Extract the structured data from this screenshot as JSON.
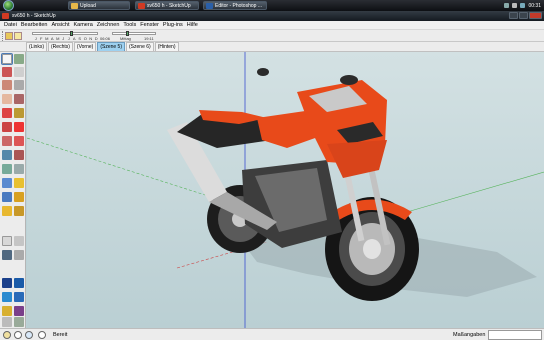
{
  "taskbar": {
    "buttons": [
      {
        "label": "Upload"
      },
      {
        "label": "sv650 h - SketchUp"
      },
      {
        "label": "Editor - Photoshop ..."
      }
    ],
    "clock": "00:31"
  },
  "window": {
    "title": "sv650 h - SketchUp"
  },
  "menu": {
    "items": [
      "Datei",
      "Bearbeiten",
      "Ansicht",
      "Kamera",
      "Zeichnen",
      "Tools",
      "Fenster",
      "Plug-ins",
      "Hilfe"
    ]
  },
  "shadow": {
    "months": [
      "J",
      "F",
      "M",
      "A",
      "M",
      "J",
      "J",
      "A",
      "S",
      "O",
      "N",
      "D"
    ],
    "time_start": "06:06",
    "noon_label": "Mittag",
    "time_end": "19:11"
  },
  "scenes": {
    "tabs": [
      "(Links)",
      "(Rechts)",
      "(Vorne)",
      "(Szene 5)",
      "(Szene 6)",
      "(Hinten)"
    ],
    "active_index": 3
  },
  "status": {
    "text": "Bereit",
    "measure_label": "Maßangaben",
    "measure_value": ""
  },
  "colors": {
    "accent_orange": "#e84a1a",
    "axis_blue": "#3a4fcf",
    "axis_green": "#55b35a",
    "active_tab": "#9ed1f0"
  }
}
